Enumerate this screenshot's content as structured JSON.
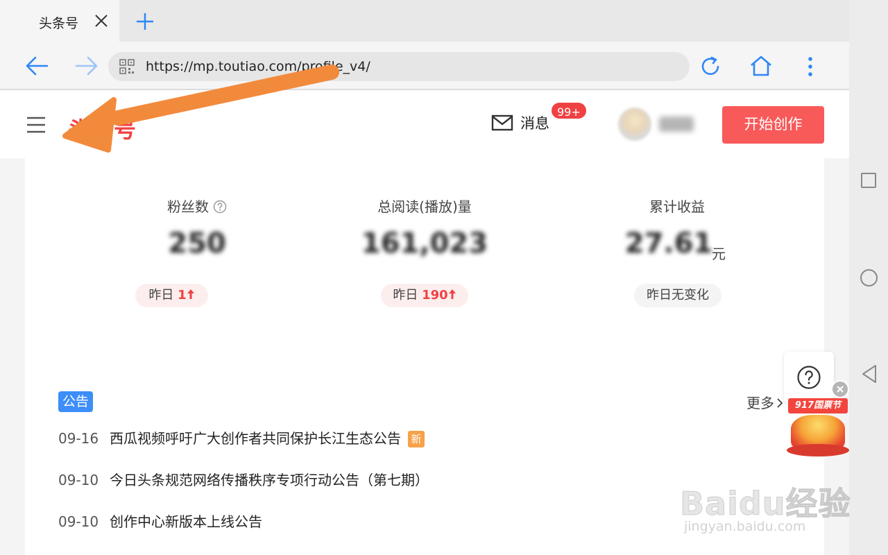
{
  "browser": {
    "tab_title": "头条号",
    "url": "https://mp.toutiao.com/profile_v4/"
  },
  "header": {
    "logo_text": "头条号",
    "messages_label": "消息",
    "messages_badge": "99+",
    "create_button": "开始创作"
  },
  "stats": [
    {
      "label": "粉丝数",
      "value": "250",
      "unit": "",
      "change_prefix": "昨日",
      "change_value": "1"
    },
    {
      "label": "总阅读(播放)量",
      "value": "161,023",
      "unit": "",
      "change_prefix": "昨日",
      "change_value": "190"
    },
    {
      "label": "累计收益",
      "value": "27.61",
      "unit": "元",
      "change_text": "昨日无变化"
    }
  ],
  "announcements": {
    "tag": "公告",
    "more_label": "更多",
    "items": [
      {
        "date": "09-16",
        "title": "西瓜视频呼吁广大创作者共同保护长江生态公告",
        "badge": "新"
      },
      {
        "date": "09-10",
        "title": "今日头条规范网络传播秩序专项行动公告（第七期）"
      },
      {
        "date": "09-10",
        "title": "创作中心新版本上线公告"
      }
    ]
  },
  "promo": {
    "tag": "917国票节"
  },
  "watermark": {
    "main": "Baidu经验",
    "sub": "jingyan.baidu.com"
  },
  "colors": {
    "brand_red": "#f04142",
    "button_red": "#f85959",
    "notice_blue": "#3d8ef8",
    "browser_blue": "#2f86f6",
    "annotation_orange": "#f28a3c"
  }
}
